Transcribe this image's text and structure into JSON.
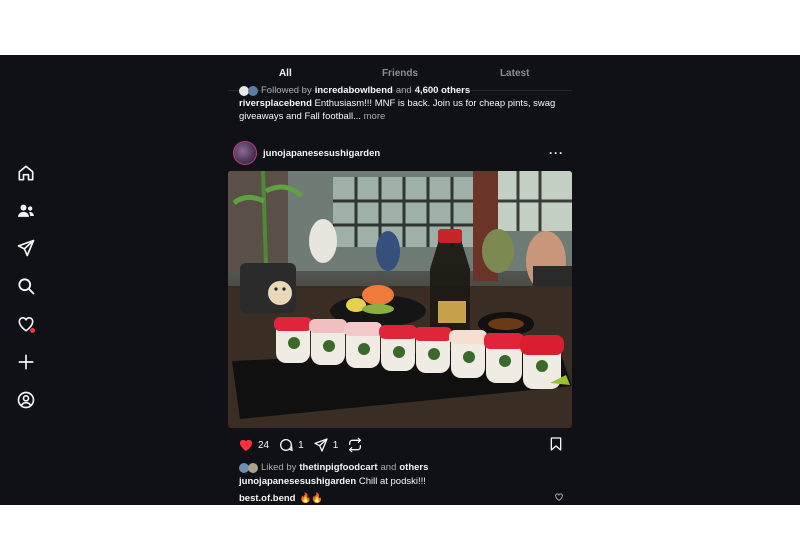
{
  "tabs": [
    {
      "label": "All",
      "active": true
    },
    {
      "label": "Friends",
      "active": false
    },
    {
      "label": "Latest",
      "active": false
    }
  ],
  "prev_post": {
    "followed_prefix": "Followed by",
    "followed_user": "incredabowlbend",
    "and_text": "and",
    "others_count": "4,600 others",
    "author": "riversplacebend",
    "caption": "Enthusiasm!!! MNF is back. Join us for cheap pints, swag giveaways and Fall football...",
    "more": "more"
  },
  "post": {
    "username": "junojapanesesushigarden",
    "more_label": "···",
    "image_desc": "sushi-roll-photo",
    "likes": "24",
    "comments": "1",
    "shares": "1",
    "liked_by_prefix": "Liked by",
    "liked_by_user": "thetinpigfoodcart",
    "liked_by_and": "and",
    "liked_by_others": "others",
    "caption_user": "junojapanesesushigarden",
    "caption_text": "Chill at podski!!!",
    "comment_user": "best.of.bend",
    "comment_text": "🔥🔥"
  },
  "colors": {
    "background": "#0f1116",
    "like_red": "#ff3040",
    "muted": "#a8abb0"
  },
  "rail_icons": [
    "home-icon",
    "people-icon",
    "send-icon",
    "search-icon",
    "heart-icon",
    "plus-icon",
    "profile-icon"
  ]
}
